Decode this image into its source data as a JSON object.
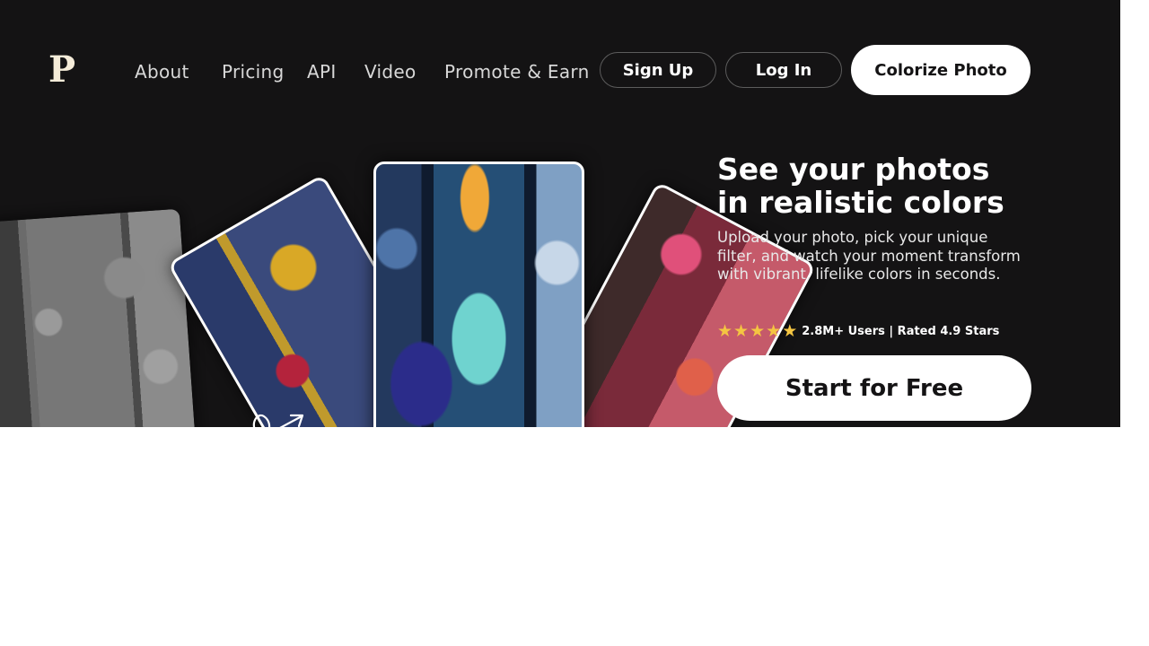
{
  "header": {
    "logo_text": "P",
    "nav": [
      {
        "label": "About"
      },
      {
        "label": "Pricing"
      },
      {
        "label": "API"
      },
      {
        "label": "Video"
      },
      {
        "label": "Promote & Earn"
      }
    ],
    "signup_label": "Sign Up",
    "login_label": "Log In",
    "cta_label": "Colorize Photo"
  },
  "hero": {
    "headline": "See your photos in realistic colors",
    "subtext": "Upload your photo, pick your unique filter, and watch your moment transform with vibrant, lifelike colors in seconds.",
    "stars": 5,
    "rating_text": "2.8M+ Users | Rated 4.9 Stars",
    "start_label": "Start for Free"
  },
  "colors": {
    "background": "#141314",
    "accent_star": "#f4c542",
    "button_bg": "#ffffff",
    "logo": "#f5ecd9"
  },
  "icons": [
    "logo-icon",
    "star-icon",
    "sketch-arrow-icon"
  ]
}
